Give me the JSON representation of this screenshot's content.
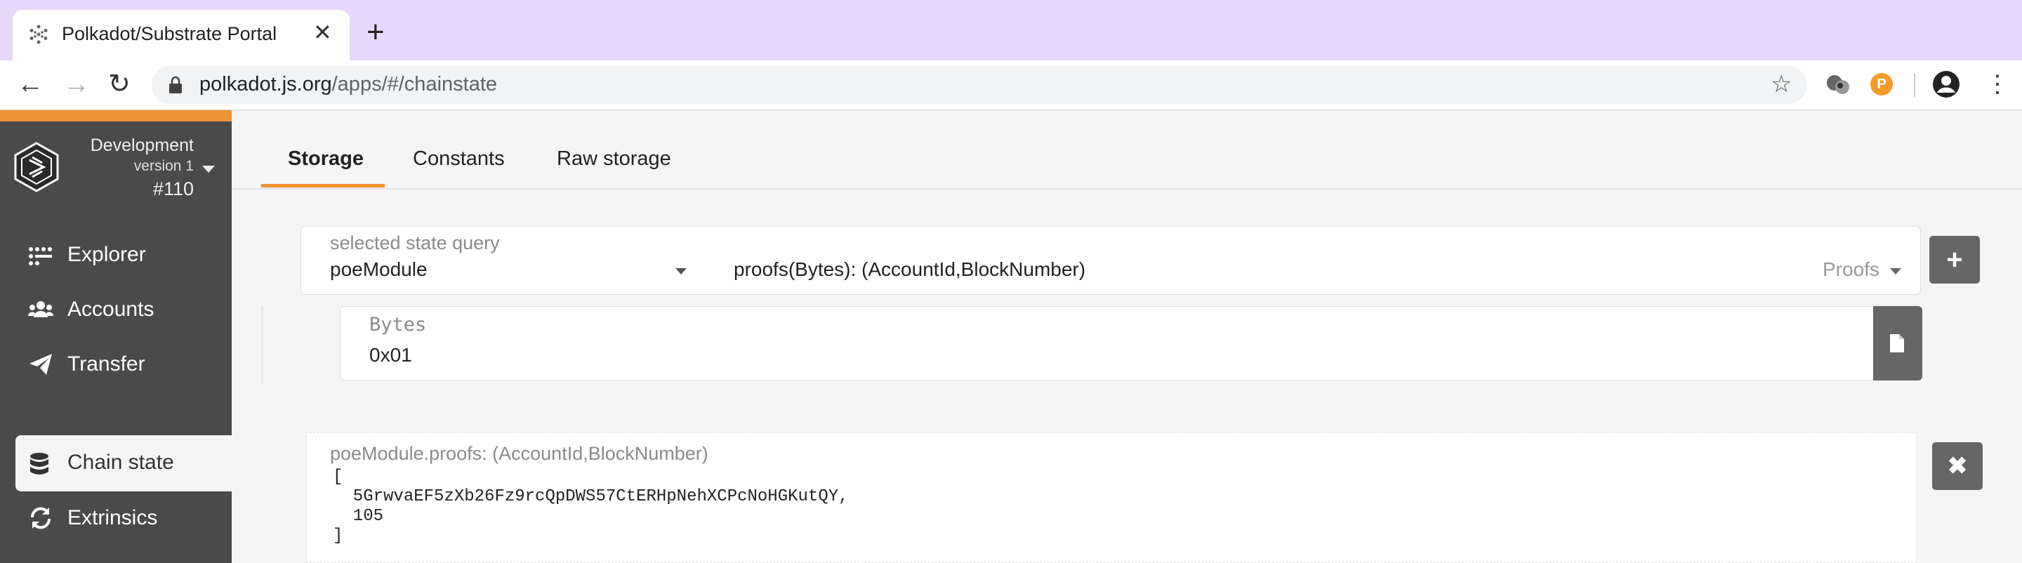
{
  "browser": {
    "tab_title": "Polkadot/Substrate Portal",
    "tab_close": "✕",
    "new_tab": "+",
    "url_host": "polkadot.js.org",
    "url_path": "/apps/#/chainstate",
    "extension_badge": "P",
    "menu": "⋮",
    "back": "←",
    "forward": "→",
    "reload": "↻",
    "star": "☆"
  },
  "sidebar": {
    "chain_name": "Development",
    "chain_version": "version 1",
    "block_number": "#110",
    "items": [
      {
        "label": "Explorer",
        "icon": "explorer-icon"
      },
      {
        "label": "Accounts",
        "icon": "users-icon"
      },
      {
        "label": "Transfer",
        "icon": "paper-plane-icon"
      },
      {
        "label": "Chain state",
        "icon": "database-icon",
        "active": true
      },
      {
        "label": "Extrinsics",
        "icon": "sync-icon"
      }
    ]
  },
  "tabs": [
    {
      "label": "Storage",
      "active": true
    },
    {
      "label": "Constants"
    },
    {
      "label": "Raw storage"
    }
  ],
  "query": {
    "label": "selected state query",
    "module": "poeModule",
    "method": "proofs(Bytes): (AccountId,BlockNumber)",
    "doc": "Proofs",
    "add_button": "+"
  },
  "param": {
    "label": "Bytes",
    "value": "0x01"
  },
  "result": {
    "label": "poeModule.proofs: (AccountId,BlockNumber)",
    "text": "[\n  5GrwvaEF5zXb26Fz9rcQpDWS57CtERHpNehXCPcNoHGKutQY,\n  105\n]",
    "remove_button": "✖"
  },
  "colors": {
    "accent": "#f19135",
    "sidebar": "#4a4a4a",
    "tabbar": "#e7d7fa",
    "button": "#666666"
  }
}
